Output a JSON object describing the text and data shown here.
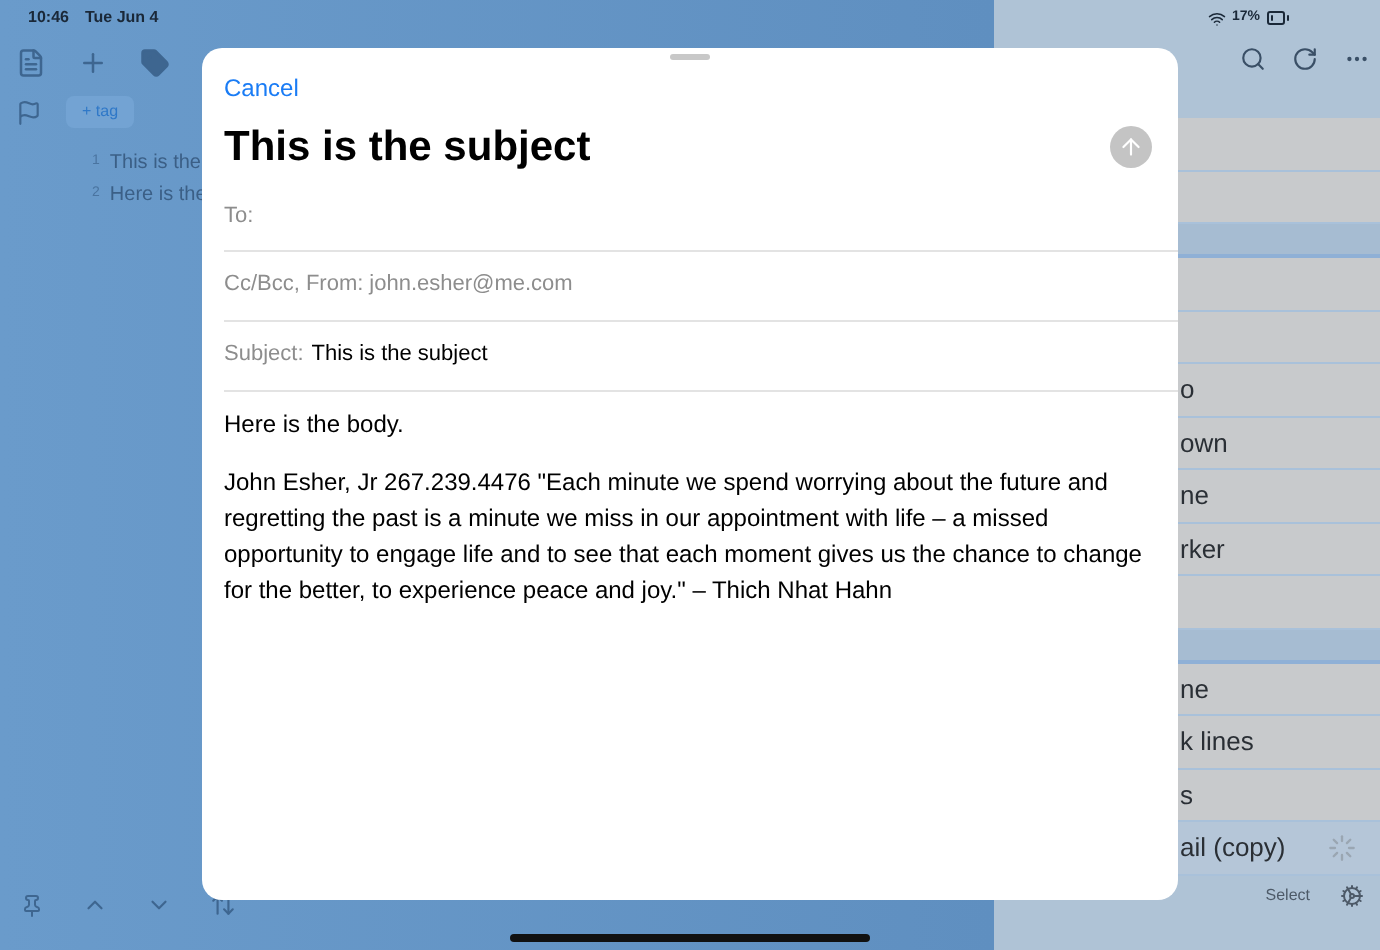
{
  "status_bar": {
    "time": "10:46",
    "date": "Tue Jun 4",
    "battery": "17%"
  },
  "editor": {
    "tag_button": "+ tag",
    "lines": [
      {
        "number": "1",
        "text": "This is the"
      },
      {
        "number": "2",
        "text": "Here is the"
      }
    ]
  },
  "list": {
    "rows": [
      {
        "kind": "row",
        "selected": false
      },
      {
        "kind": "row",
        "selected": false
      },
      {
        "kind": "section"
      },
      {
        "kind": "row",
        "selected": false
      },
      {
        "kind": "row",
        "selected": false
      },
      {
        "kind": "row",
        "text": "o",
        "selected": false
      },
      {
        "kind": "row",
        "text": "own",
        "selected": false
      },
      {
        "kind": "row",
        "text": "ne",
        "selected": false
      },
      {
        "kind": "row",
        "text": "rker",
        "selected": false
      },
      {
        "kind": "row",
        "selected": false
      },
      {
        "kind": "section"
      },
      {
        "kind": "row",
        "text": "ne",
        "selected": false
      },
      {
        "kind": "row",
        "text": "k lines",
        "selected": false
      },
      {
        "kind": "row",
        "text": "s",
        "selected": false
      },
      {
        "kind": "row",
        "text": "ail (copy)",
        "selected": true
      }
    ]
  },
  "bottom_bar": {
    "select": "Select"
  },
  "compose": {
    "cancel": "Cancel",
    "title": "This is the subject",
    "to_label": "To:",
    "from_label": "Cc/Bcc, From:",
    "from_value": "john.esher@me.com",
    "subject_label": "Subject:",
    "subject_value": "This is the subject",
    "body": [
      "Here is the body.",
      "John Esher, Jr 267.239.4476 \"Each minute we spend worrying about the future and regretting the past is a minute we miss in our appointment with life – a missed opportunity to engage life and to see that each moment gives us the chance to change for the better, to experience peace and joy.\" – Thich Nhat Hahn"
    ]
  }
}
